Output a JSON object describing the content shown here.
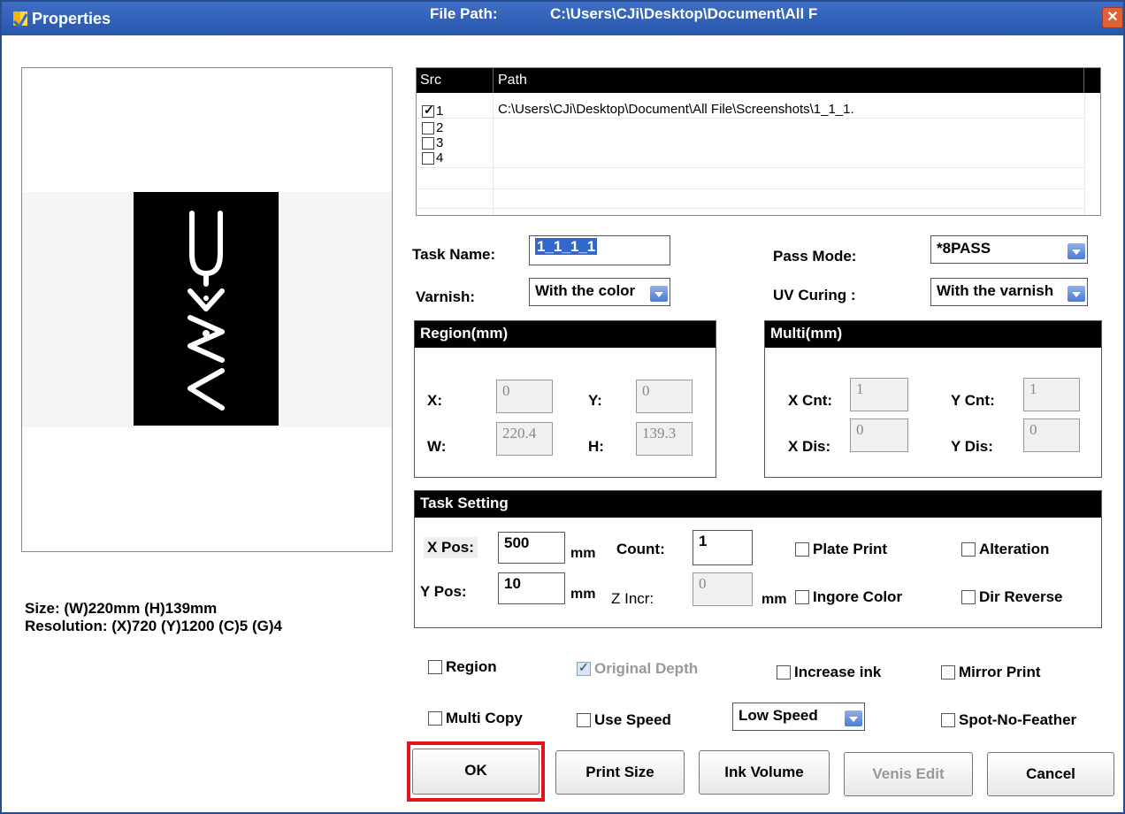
{
  "titlebar": {
    "title": "Properties",
    "file_path_label": "File Path:",
    "file_path_value": "C:\\Users\\CJi\\Desktop\\Document\\All F",
    "close": "✕"
  },
  "info": {
    "size": "Size: (W)220mm (H)139mm",
    "resolution": "Resolution: (X)720  (Y)1200 (C)5 (G)4"
  },
  "table": {
    "headers": [
      "Src",
      "Path"
    ],
    "rows": [
      {
        "src": "1",
        "checked": true,
        "path": "C:\\Users\\CJi\\Desktop\\Document\\All File\\Screenshots\\1_1_1."
      },
      {
        "src": "2",
        "checked": false,
        "path": ""
      },
      {
        "src": "3",
        "checked": false,
        "path": ""
      },
      {
        "src": "4",
        "checked": false,
        "path": ""
      }
    ]
  },
  "task": {
    "name_label": "Task Name:",
    "name_value": "1_1_1_1",
    "pass_label": "Pass Mode:",
    "pass_value": "*8PASS",
    "varnish_label": "Varnish:",
    "varnish_value": "With the color",
    "uv_label": "UV Curing :",
    "uv_value": "With the varnish"
  },
  "region": {
    "title": "Region(mm)",
    "x_label": "X:",
    "x_value": "0",
    "y_label": "Y:",
    "y_value": "0",
    "w_label": "W:",
    "w_value": "220.4",
    "h_label": "H:",
    "h_value": "139.3"
  },
  "multi": {
    "title": "Multi(mm)",
    "xcnt_label": "X Cnt:",
    "xcnt_value": "1",
    "ycnt_label": "Y Cnt:",
    "ycnt_value": "1",
    "xdis_label": "X Dis:",
    "xdis_value": "0",
    "ydis_label": "Y Dis:",
    "ydis_value": "0"
  },
  "task_setting": {
    "title": "Task Setting",
    "xpos_label": "X Pos:",
    "xpos_value": "500",
    "mm1": "mm",
    "ypos_label": "Y Pos:",
    "ypos_value": "10",
    "mm2": "mm",
    "count_label": "Count:",
    "count_value": "1",
    "zincr_label": "Z Incr:",
    "zincr_value": "0",
    "mm3": "mm",
    "plate_print": "Plate Print",
    "alteration": "Alteration",
    "ignore_color": "Ingore Color",
    "dir_reverse": "Dir Reverse"
  },
  "options": {
    "region": "Region",
    "original_depth": "Original Depth",
    "increase_ink": "Increase ink",
    "mirror_print": "Mirror Print",
    "multi_copy": "Multi Copy",
    "use_speed": "Use Speed",
    "speed_value": "Low Speed",
    "spot_no_feather": "Spot-No-Feather"
  },
  "buttons": {
    "ok": "OK",
    "print_size": "Print Size",
    "ink_volume": "Ink Volume",
    "venis_edit": "Venis Edit",
    "cancel": "Cancel"
  }
}
